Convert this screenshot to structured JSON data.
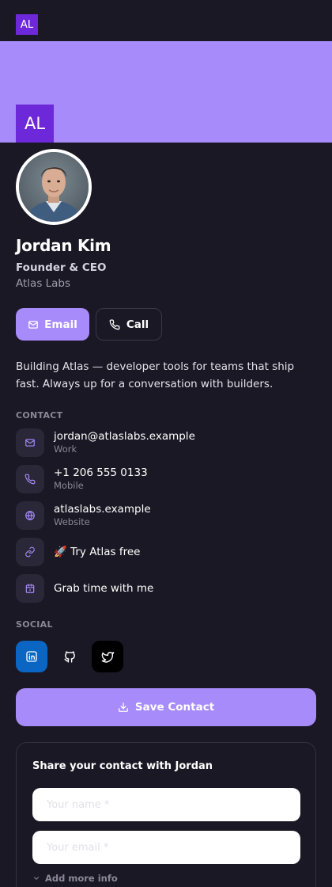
{
  "brand": {
    "initials": "AL",
    "banner_color": "#a78bfa",
    "logo_color": "#6d28d9"
  },
  "profile": {
    "name": "Jordan Kim",
    "title": "Founder & CEO",
    "company": "Atlas Labs",
    "bio": "Building Atlas — developer tools for teams that ship fast. Always up for a conversation with builders."
  },
  "actions": {
    "email_label": "Email",
    "call_label": "Call"
  },
  "contact": {
    "label": "CONTACT",
    "items": [
      {
        "icon": "mail-icon",
        "value": "jordan@atlaslabs.example",
        "sub": "Work"
      },
      {
        "icon": "phone-icon",
        "value": "+1 206 555 0133",
        "sub": "Mobile"
      },
      {
        "icon": "globe-icon",
        "value": "atlaslabs.example",
        "sub": "Website"
      },
      {
        "icon": "link-icon",
        "value": "🚀 Try Atlas free"
      },
      {
        "icon": "calendar-icon",
        "value": "Grab time with me"
      }
    ]
  },
  "social": {
    "label": "SOCIAL",
    "items": [
      {
        "icon": "linkedin-icon",
        "color": "#0a66c2"
      },
      {
        "icon": "github-icon",
        "color": "#1a1824"
      },
      {
        "icon": "twitter-icon",
        "color": "#000000"
      }
    ]
  },
  "save": {
    "label": "Save Contact"
  },
  "share_form": {
    "title": "Share your contact with Jordan",
    "name_placeholder": "Your name *",
    "email_placeholder": "Your email *",
    "more_label": "Add more info"
  }
}
